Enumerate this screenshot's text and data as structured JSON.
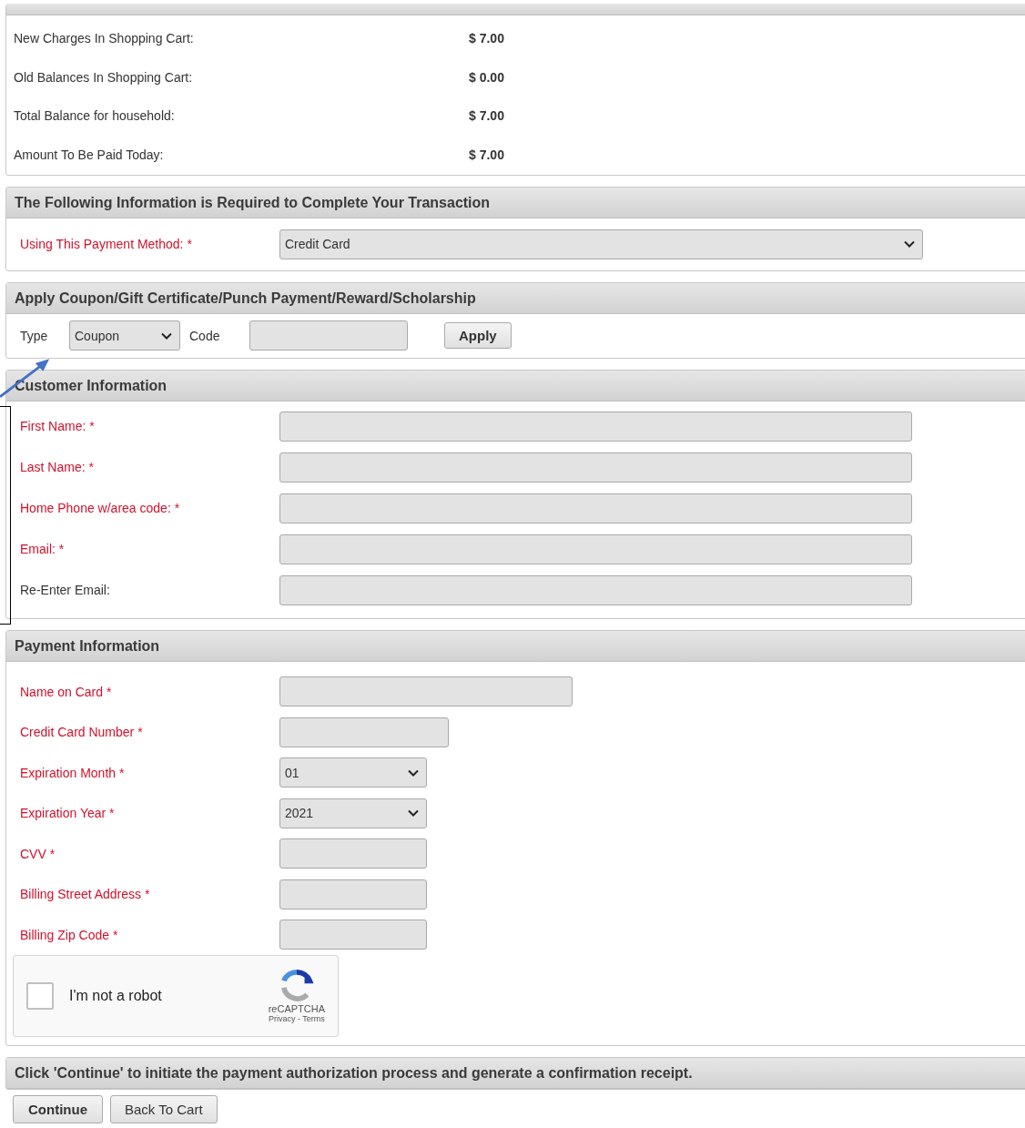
{
  "summary": {
    "rows": [
      {
        "label": "New Charges In Shopping Cart:",
        "amount": "$ 7.00"
      },
      {
        "label": "Old Balances In Shopping Cart:",
        "amount": "$ 0.00"
      },
      {
        "label": "Total Balance for household:",
        "amount": "$ 7.00"
      },
      {
        "label": "Amount To Be Paid Today:",
        "amount": "$ 7.00"
      }
    ]
  },
  "required_info": {
    "title": "The Following Information is Required to Complete Your Transaction",
    "label": "Using This Payment Method: *",
    "required": true,
    "value": "Credit Card"
  },
  "coupon": {
    "title": "Apply Coupon/Gift Certificate/Punch Payment/Reward/Scholarship",
    "type_label": "Type",
    "type_value": "Coupon",
    "code_label": "Code",
    "button": "Apply"
  },
  "customer": {
    "title": "Customer Information",
    "fields": [
      {
        "label": "First Name: *",
        "required": true,
        "kind": "text"
      },
      {
        "label": "Last Name: *",
        "required": true,
        "kind": "text"
      },
      {
        "label": "Home Phone w/area code: *",
        "required": true,
        "kind": "text"
      },
      {
        "label": "Email: *",
        "required": true,
        "kind": "text"
      },
      {
        "label": "Re-Enter Email:",
        "required": false,
        "kind": "text"
      }
    ]
  },
  "payment": {
    "title": "Payment Information",
    "fields": [
      {
        "label": "Name on Card *",
        "required": true,
        "kind": "text"
      },
      {
        "label": "Credit Card Number *",
        "required": true,
        "kind": "text"
      },
      {
        "label": "Expiration Month *",
        "required": true,
        "kind": "select",
        "value": "01"
      },
      {
        "label": "Expiration Year *",
        "required": true,
        "kind": "select",
        "value": "2021"
      },
      {
        "label": "CVV *",
        "required": true,
        "kind": "text"
      },
      {
        "label": "Billing Street Address *",
        "required": true,
        "kind": "text"
      },
      {
        "label": "Billing Zip Code *",
        "required": true,
        "kind": "text"
      }
    ],
    "captcha": {
      "label": "I'm not a robot",
      "checked": false,
      "brand": "reCAPTCHA",
      "links": "Privacy - Terms"
    }
  },
  "footer": {
    "title": "Click 'Continue' to initiate the payment authorization process and generate a confirmation receipt.",
    "buttons": [
      {
        "label": "Continue",
        "primary": true
      },
      {
        "label": "Back To Cart",
        "primary": false
      }
    ]
  }
}
